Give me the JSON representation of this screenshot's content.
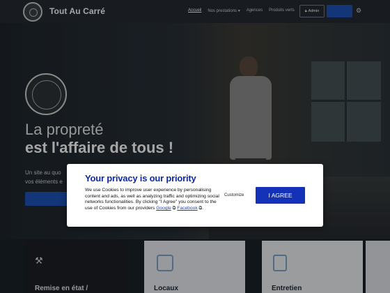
{
  "header": {
    "brand": "Tout Au Carré",
    "nav": [
      {
        "label": "Accueil",
        "active": true
      },
      {
        "label": "Nos prestations ▾",
        "active": false
      },
      {
        "label": "Agences",
        "active": false
      },
      {
        "label": "Produits verts",
        "active": false
      }
    ],
    "admin_label": "Admin",
    "icons": {
      "logo": "company-seal",
      "settings": "gear-icon"
    }
  },
  "hero": {
    "line1": "La propreté",
    "line2": "est l'affaire de tous !",
    "sub1": "Un site au quo",
    "sub2": "vos éléments e"
  },
  "cards": [
    {
      "title": "Remise en état /",
      "icon": "tools-icon"
    },
    {
      "title": "Locaux",
      "icon": "building-icon"
    },
    {
      "title": "Entretien",
      "icon": "document-icon"
    }
  ],
  "cookie_modal": {
    "title": "Your privacy is our priority",
    "text_before": "We use Cookies to improve user experience by personalising content and ads, as well as analyzing traffic and optimizing social networks functionalities. By clicking \"I Agree\" you consent to the use of Cookies from our providers ",
    "link_google": "Google",
    "link_sep": " ",
    "link_facebook": "Facebook",
    "text_after": ".",
    "customize_label": "Customize",
    "agree_label": "I AGREE"
  },
  "colors": {
    "brand_blue": "#1e54ba",
    "modal_title": "#0c2aa4",
    "agree_button": "#1432b8"
  }
}
